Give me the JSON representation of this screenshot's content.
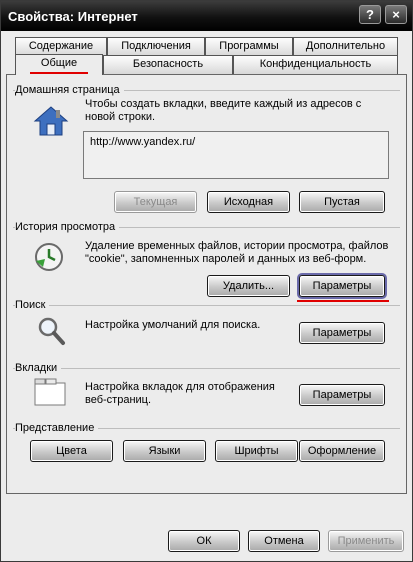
{
  "window": {
    "title": "Свойства: Интернет"
  },
  "titlebar_buttons": {
    "help": "?",
    "close": "×"
  },
  "tabs_row1": [
    "Содержание",
    "Подключения",
    "Программы",
    "Дополнительно"
  ],
  "tabs_row2": [
    "Общие",
    "Безопасность",
    "Конфиденциальность"
  ],
  "home": {
    "title": "Домашняя страница",
    "description": "Чтобы создать вкладки, введите каждый из адресов с новой строки.",
    "url": "http://www.yandex.ru/",
    "btn_current": "Текущая",
    "btn_default": "Исходная",
    "btn_blank": "Пустая"
  },
  "history": {
    "title": "История просмотра",
    "description": "Удаление временных файлов, истории просмотра, файлов \"cookie\", запомненных паролей и данных из веб-форм.",
    "btn_delete": "Удалить...",
    "btn_settings": "Параметры"
  },
  "search": {
    "title": "Поиск",
    "description": "Настройка умолчаний для поиска.",
    "btn_settings": "Параметры"
  },
  "tabs_section": {
    "title": "Вкладки",
    "description": "Настройка вкладок для отображения веб-страниц.",
    "btn_settings": "Параметры"
  },
  "appearance": {
    "title": "Представление",
    "btn_colors": "Цвета",
    "btn_languages": "Языки",
    "btn_fonts": "Шрифты",
    "btn_style": "Оформление"
  },
  "footer": {
    "ok": "ОК",
    "cancel": "Отмена",
    "apply": "Применить"
  },
  "colors": {
    "accent_red": "#e00000",
    "titlebar": "#111111"
  },
  "icons": {
    "home": "house-icon",
    "history": "clock-arrow-icon",
    "search": "magnifier-icon",
    "tabs": "tabbed-window-icon"
  }
}
